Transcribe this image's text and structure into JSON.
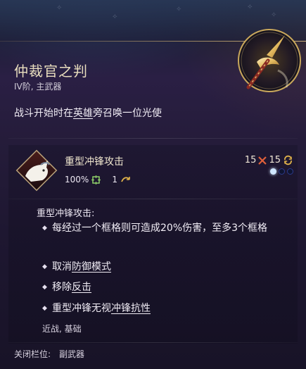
{
  "item": {
    "name": "仲裁官之判",
    "type_line": "IV阶, 主武器",
    "description_prefix": "战斗开始时在",
    "description_link": "英雄",
    "description_suffix": "旁召唤一位光使"
  },
  "action": {
    "name": "重型冲锋攻击",
    "hit_chance": "100%",
    "ap_cost": "1",
    "focus_cost_a": "15",
    "focus_cost_b": "15",
    "pips_filled": 1,
    "pips_total": 3
  },
  "effects": {
    "header": "重型冲锋攻击:",
    "bullet_1": "每经过一个框格则可造成20%伤害，至多3个框格",
    "bullet_2_prefix": "取消",
    "bullet_2_link": "防御模式",
    "bullet_3_prefix": "移除",
    "bullet_3_link": "反击",
    "bullet_4_prefix": "重型冲锋无视",
    "bullet_4_link": "冲锋抗性",
    "tags": "近战, 基础"
  },
  "footer": {
    "slot_label": "关闭栏位:",
    "slot_value": "副武器"
  },
  "icons": {
    "emblem": "golden-spear-emblem-icon",
    "action": "charging-ram-icon",
    "hit": "target-crosshair-icon",
    "ap": "arrow-hook-icon",
    "focus": "crossed-blades-icon",
    "recharge": "cycle-arrows-icon"
  },
  "colors": {
    "title": "#eadfbf",
    "accent_gold": "#d8b46a",
    "hit_green": "#8fd16a",
    "pip_active": "#cfe6ff",
    "pip_empty": "#2b3a8a"
  }
}
